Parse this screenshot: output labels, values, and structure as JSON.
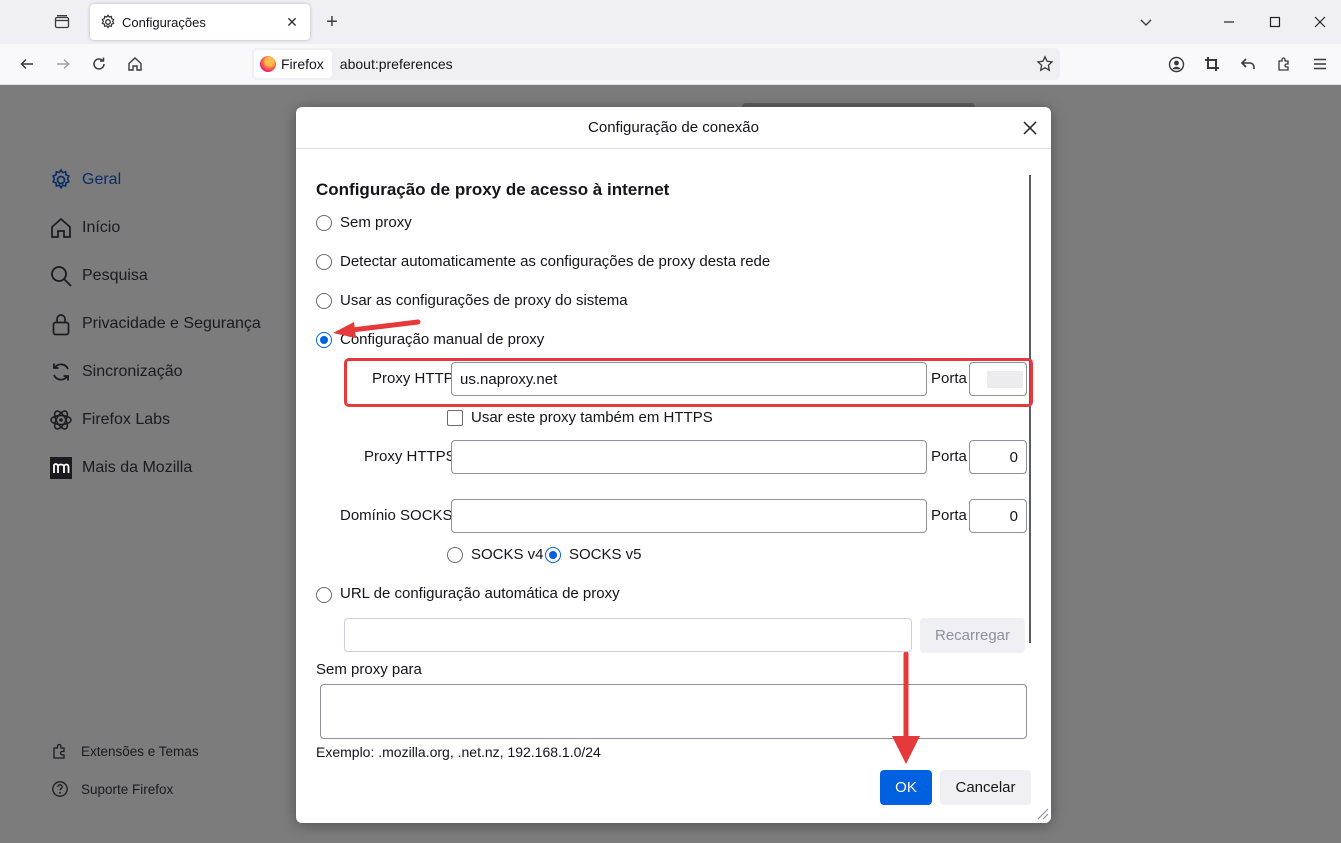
{
  "browser": {
    "tab_title": "Configurações",
    "identity_label": "Firefox",
    "url": "about:preferences"
  },
  "sidebar": {
    "items": [
      {
        "label": "Geral",
        "icon": "gear-icon",
        "active": true
      },
      {
        "label": "Início",
        "icon": "home-icon"
      },
      {
        "label": "Pesquisa",
        "icon": "search-icon"
      },
      {
        "label": "Privacidade e Segurança",
        "icon": "lock-icon"
      },
      {
        "label": "Sincronização",
        "icon": "sync-icon"
      },
      {
        "label": "Firefox Labs",
        "icon": "labs-icon"
      },
      {
        "label": "Mais da Mozilla",
        "icon": "mozilla-icon"
      }
    ],
    "footer": [
      {
        "label": "Extensões e Temas",
        "icon": "puzzle-icon"
      },
      {
        "label": "Suporte Firefox",
        "icon": "help-icon"
      }
    ]
  },
  "dialog": {
    "title": "Configuração de conexão",
    "section_heading": "Configuração de proxy de acesso à internet",
    "options": {
      "no_proxy": "Sem proxy",
      "auto_detect": "Detectar automaticamente as configurações de proxy desta rede",
      "system": "Usar as configurações de proxy do sistema",
      "manual": "Configuração manual de proxy",
      "pac_url": "URL de configuração automática de proxy"
    },
    "selected_option": "manual",
    "http_proxy": {
      "label": "Proxy HTTP",
      "value": "us.naproxy.net",
      "port_label": "Porta",
      "port": ""
    },
    "also_https": {
      "label": "Usar este proxy também em HTTPS",
      "checked": false
    },
    "https_proxy": {
      "label": "Proxy HTTPS",
      "value": "",
      "port_label": "Porta",
      "port": "0"
    },
    "socks": {
      "label": "Domínio SOCKS",
      "value": "",
      "port_label": "Porta",
      "port": "0",
      "v4": "SOCKS v4",
      "v5": "SOCKS v5",
      "selected": "v5"
    },
    "pac": {
      "value": "",
      "reload_label": "Recarregar"
    },
    "no_proxy_for": {
      "label": "Sem proxy para",
      "value": ""
    },
    "example": "Exemplo: .mozilla.org, .net.nz, 192.168.1.0/24",
    "ok_label": "OK",
    "cancel_label": "Cancelar"
  },
  "colors": {
    "accent": "#0061e0",
    "annotation": "#e5393b"
  }
}
